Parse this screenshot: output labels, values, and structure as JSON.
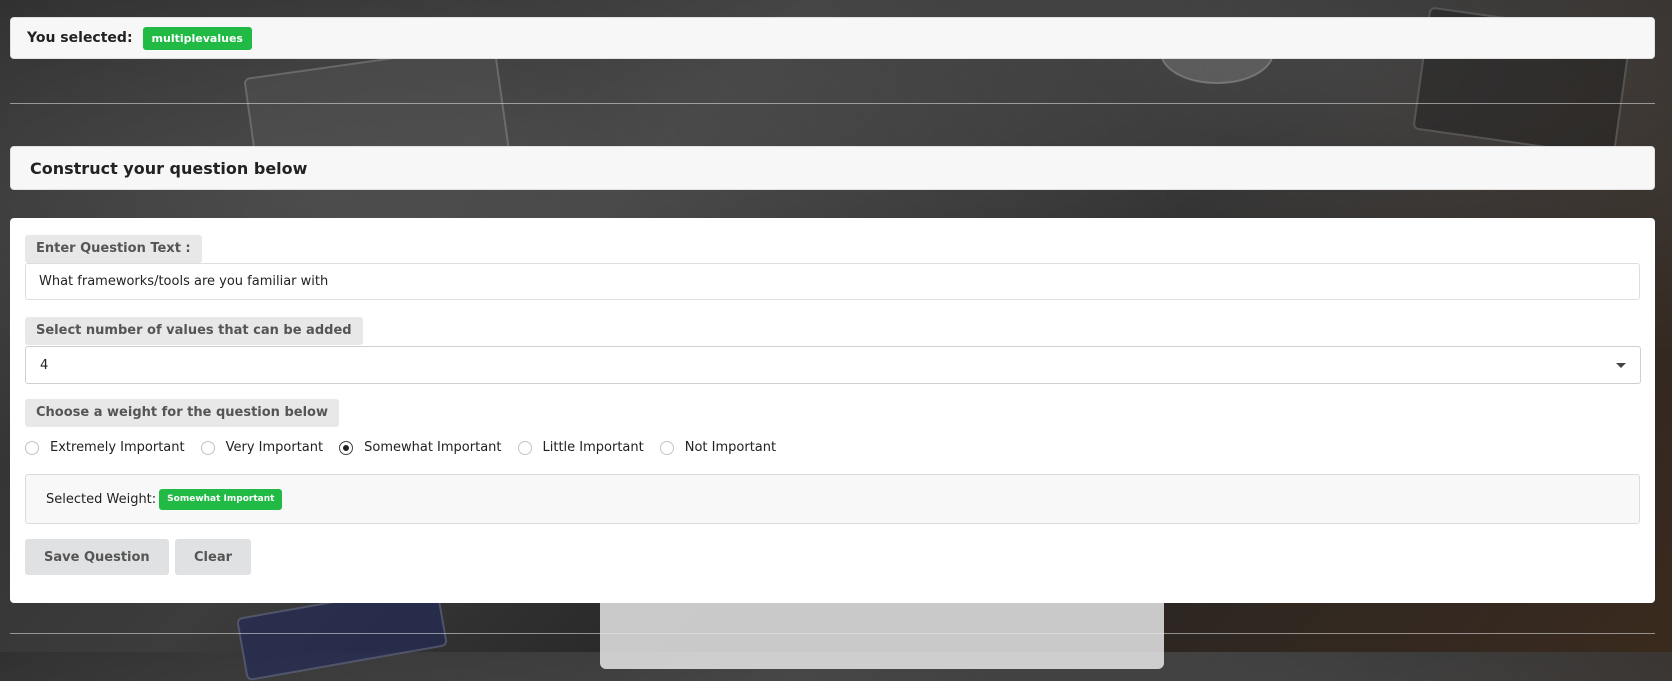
{
  "selection": {
    "label": "You selected:",
    "value": "multiplevalues"
  },
  "header": {
    "title": "Construct your question below"
  },
  "form": {
    "question_label": "Enter Question Text :",
    "question_value": "What frameworks/tools are you familiar with",
    "values_label": "Select number of values that can be added",
    "values_selected": "4",
    "weight_label": "Choose a weight for the question below",
    "weights": [
      {
        "label": "Extremely Important",
        "checked": false
      },
      {
        "label": "Very Important",
        "checked": false
      },
      {
        "label": "Somewhat Important",
        "checked": true
      },
      {
        "label": "Little Important",
        "checked": false
      },
      {
        "label": "Not Important",
        "checked": false
      }
    ],
    "selected_weight_label": "Selected Weight:",
    "selected_weight_value": "Somewhat Important"
  },
  "buttons": {
    "save_label": "Save Question",
    "clear_label": "Clear"
  },
  "colors": {
    "badge": "#21ba45",
    "label_bg": "#e8e8e8",
    "button_bg": "#e0e1e2"
  }
}
